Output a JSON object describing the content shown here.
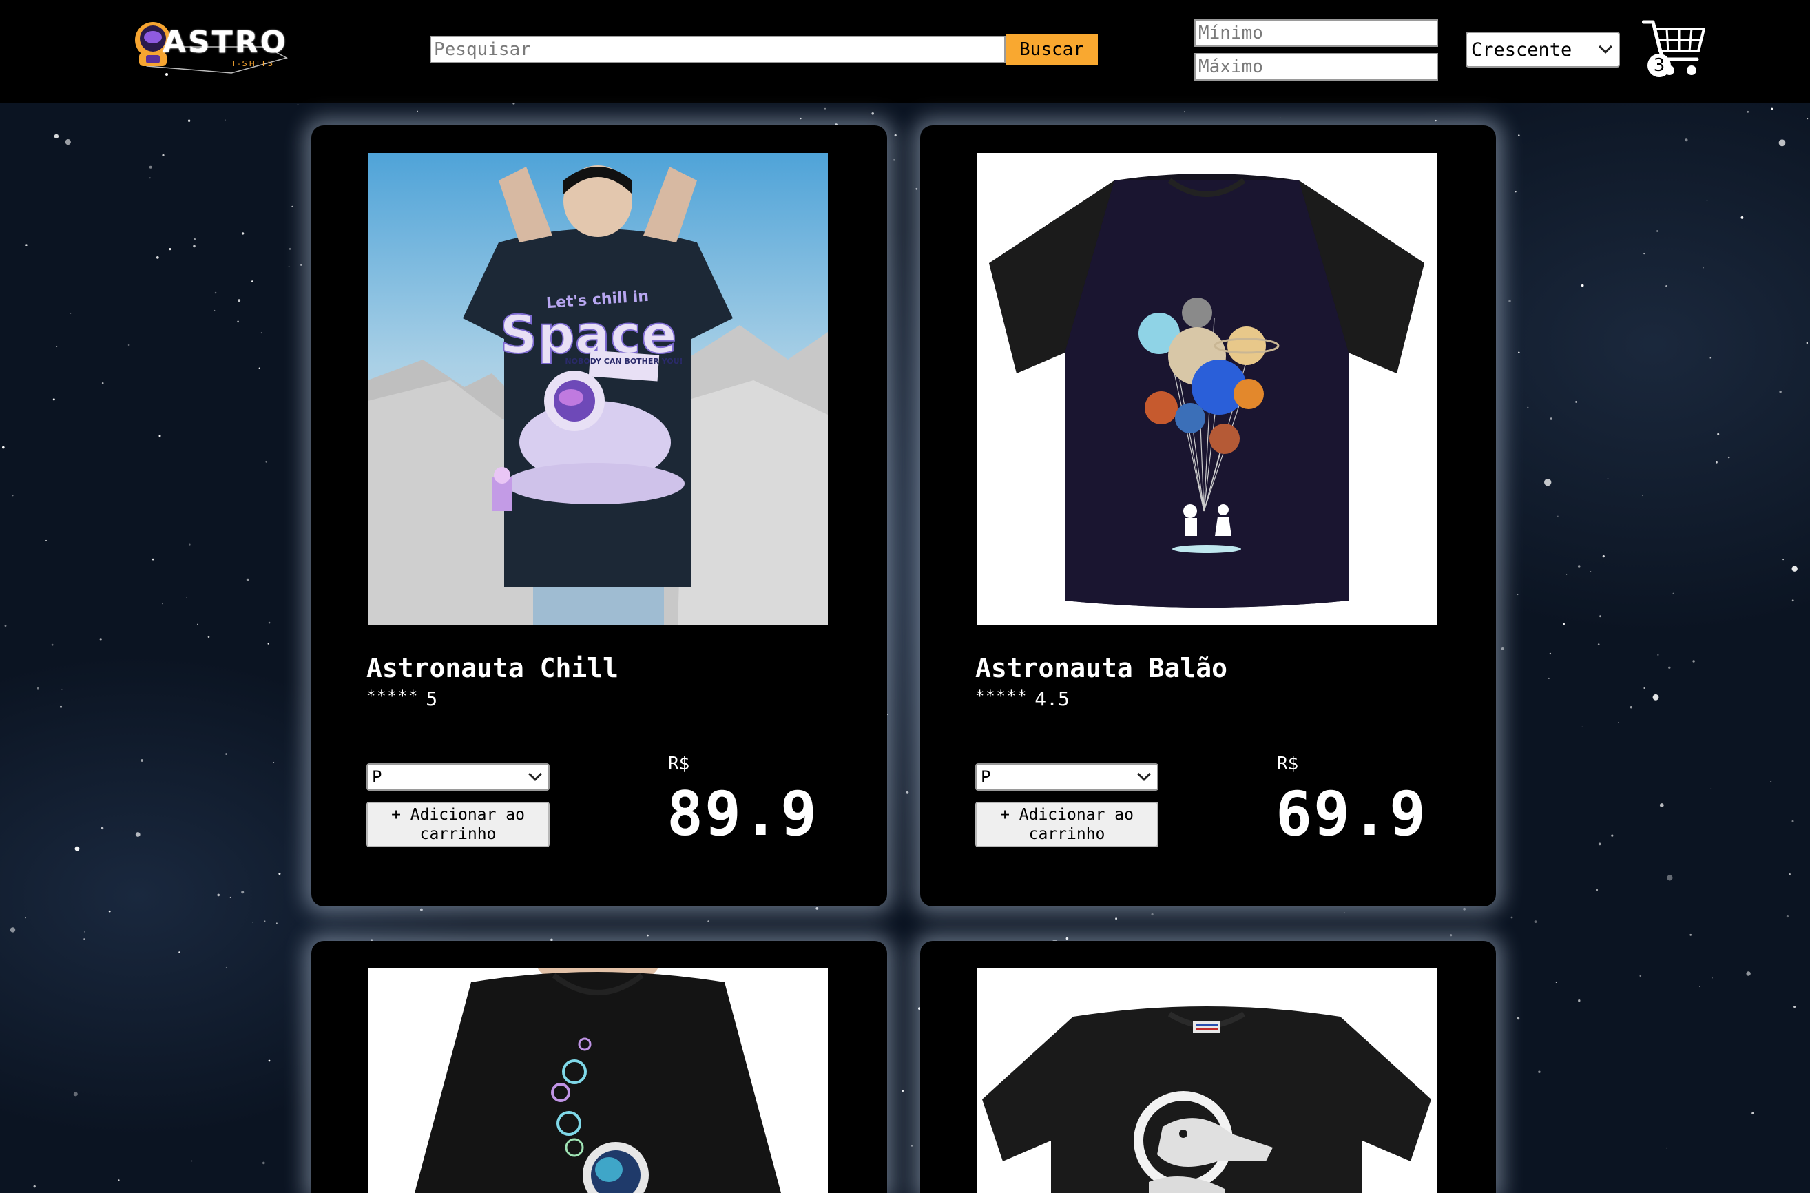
{
  "header": {
    "logo_text": "ASTRO",
    "logo_sub": "T-SHITS",
    "search_placeholder": "Pesquisar",
    "search_button": "Buscar",
    "min_placeholder": "Mínimo",
    "max_placeholder": "Máximo",
    "sort_value": "Crescente",
    "cart_count": "3",
    "cart_icon": "cart-icon",
    "accent_color": "#f9a830"
  },
  "products": [
    {
      "name": "Astronauta Chill",
      "stars": "*****",
      "rating": "5",
      "size": "P",
      "add_label": "+ Adicionar ao carrinho",
      "currency": "R$",
      "price": "89.9",
      "image_text_1": "Let's chill in",
      "image_text_2": "Space",
      "image_text_3": "NOBODY CAN BOTHER YOU!"
    },
    {
      "name": "Astronauta Balão",
      "stars": "*****",
      "rating": "4.5",
      "size": "P",
      "add_label": "+ Adicionar ao carrinho",
      "currency": "R$",
      "price": "69.9"
    },
    {
      "image_icon": "astronaut-bubbles-shirt-image"
    },
    {
      "image_icon": "reptile-astronaut-shirt-image"
    }
  ]
}
